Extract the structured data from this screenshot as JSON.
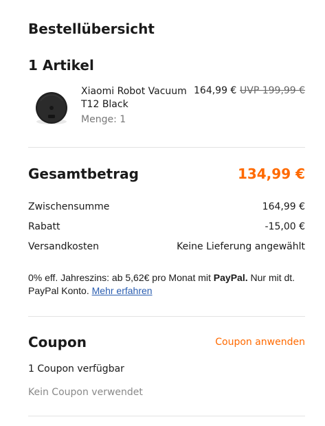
{
  "order_summary": {
    "title": "Bestellübersicht",
    "items_heading": "1 Artikel"
  },
  "product": {
    "image_icon": "robot-vacuum-image",
    "name": "Xiaomi Robot Vacuum T12 Black",
    "quantity": "Menge: 1",
    "price": "164,99 €",
    "uvp": "UVP 199,99 €"
  },
  "totals": {
    "label": "Gesamtbetrag",
    "value": "134,99 €",
    "rows": [
      {
        "label": "Zwischensumme",
        "value": "164,99 €"
      },
      {
        "label": "Rabatt",
        "value": "-15,00 €"
      },
      {
        "label": "Versandkosten",
        "value": "Keine Lieferung angewählt"
      }
    ]
  },
  "paypal": {
    "text_before": "0% eff. Jahreszins: ab 5,62€ pro Monat mit ",
    "brand": "PayPal.",
    "text_after": " Nur mit dt. PayPal Konto. ",
    "link": "Mehr erfahren"
  },
  "coupon": {
    "title": "Coupon",
    "apply_label": "Coupon anwenden",
    "available": "1 Coupon verfügbar",
    "none_used": "Kein Coupon verwendet"
  },
  "colors": {
    "accent": "#ff6a00",
    "link": "#2a5db0",
    "divider": "#e3e3e3"
  }
}
